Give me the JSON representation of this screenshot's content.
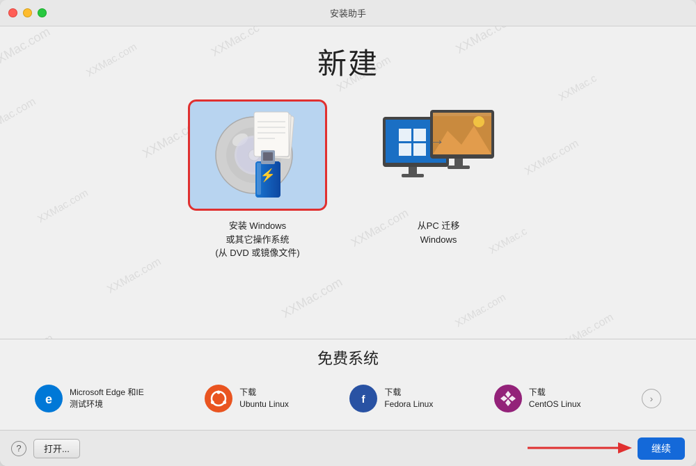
{
  "window": {
    "title": "安装助手"
  },
  "top": {
    "section_title": "新建",
    "option1": {
      "label": "安装 Windows\n或其它操作系统\n(从 DVD 或镜像文件)"
    },
    "option2": {
      "label": "从PC 迁移\nWindows"
    }
  },
  "bottom": {
    "section_title": "免费系统",
    "systems": [
      {
        "name": "edge",
        "line1": "Microsoft Edge 和IE",
        "line2": "测试环境",
        "download_label": ""
      },
      {
        "name": "ubuntu",
        "line1": "下载",
        "line2": "Ubuntu Linux",
        "download_label": "下载"
      },
      {
        "name": "fedora",
        "line1": "下载",
        "line2": "Fedora Linux",
        "download_label": "下载"
      },
      {
        "name": "centos",
        "line1": "下载",
        "line2": "CentOS Linux",
        "download_label": "下载"
      }
    ]
  },
  "toolbar": {
    "help_label": "?",
    "open_label": "打开...",
    "continue_label": "继续"
  },
  "watermark": "XXMac.com"
}
